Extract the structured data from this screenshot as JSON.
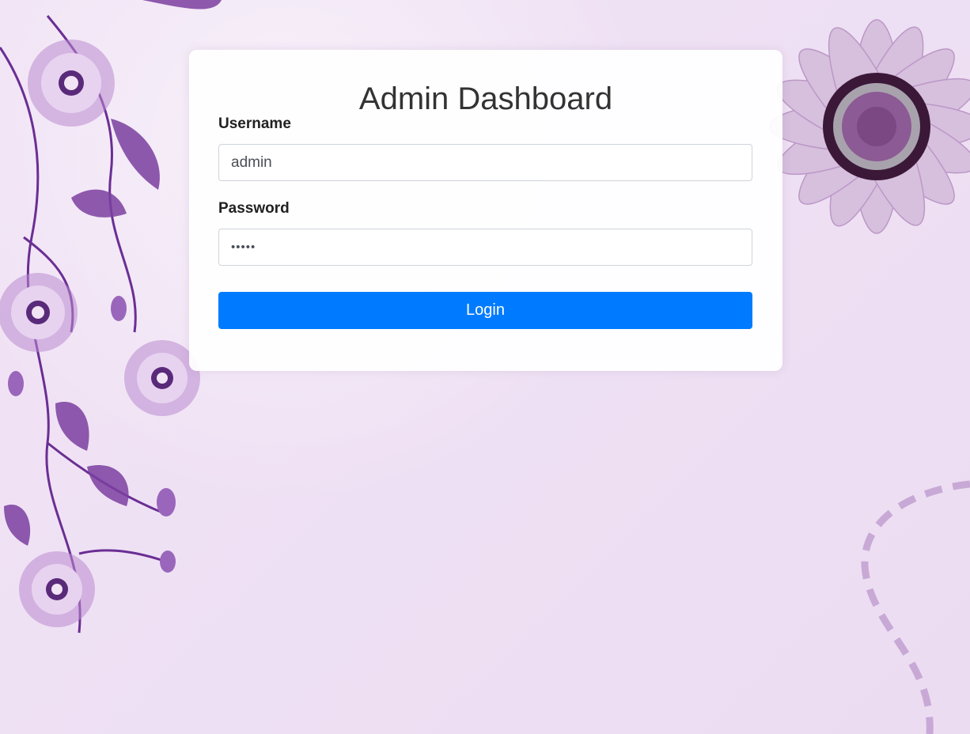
{
  "page": {
    "title": "Admin Dashboard"
  },
  "form": {
    "username_label": "Username",
    "username_value": "admin",
    "password_label": "Password",
    "password_value": "•••••",
    "login_label": "Login"
  },
  "colors": {
    "primary_button": "#007bff",
    "background": "#efe1f4",
    "floral_dark": "#7b3fa0",
    "floral_light": "#d9bfe0"
  }
}
